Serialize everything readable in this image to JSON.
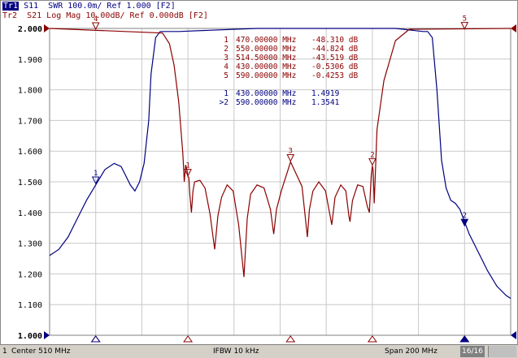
{
  "header": {
    "tr1_tag": "Tr1",
    "tr1_text": " S11  SWR 100.0m/ Ref 1.000 [F2]",
    "tr2_text": "Tr2  S21 Log Mag 10.00dB/ Ref 0.000dB [F2]"
  },
  "colors": {
    "tr1": "#000080",
    "tr2": "#8b0000",
    "grid": "#c8c8c8",
    "background": "#ffffff"
  },
  "marker_table": {
    "tr2": [
      {
        "num": "1",
        "freq": "470.00000 MHz",
        "value": "-48.310 dB"
      },
      {
        "num": "2",
        "freq": "550.00000 MHz",
        "value": "-44.824 dB"
      },
      {
        "num": "3",
        "freq": "514.50000 MHz",
        "value": "-43.519 dB"
      },
      {
        "num": "4",
        "freq": "430.00000 MHz",
        "value": "-0.5306 dB"
      },
      {
        "num": "5",
        "freq": "590.00000 MHz",
        "value": "-0.4253 dB"
      }
    ],
    "tr1": [
      {
        "num": "1",
        "freq": "430.00000 MHz",
        "value": "1.4919"
      },
      {
        "num": ">2",
        "freq": "590.00000 MHz",
        "value": "1.3541"
      }
    ]
  },
  "status": {
    "channel": "1",
    "start": "Center 510 MHz",
    "ifbw": "IFBW 10 kHz",
    "stop": "Span 200 MHz",
    "count": "16/16"
  },
  "chart_data": {
    "type": "line",
    "xlabel": "",
    "ylabel": "",
    "xlim": [
      410,
      610
    ],
    "ylim": [
      1.0,
      2.0
    ],
    "y_ticks": [
      "1.000",
      "1.100",
      "1.200",
      "1.300",
      "1.400",
      "1.500",
      "1.600",
      "1.700",
      "1.800",
      "1.900",
      "2.000"
    ],
    "grid": true,
    "series": [
      {
        "name": "Tr1",
        "color": "#000080",
        "x": [
          410,
          414,
          418,
          422,
          426,
          430,
          434,
          438,
          441,
          443,
          445,
          447,
          449,
          451,
          453,
          454,
          456,
          458,
          460,
          466,
          500,
          560,
          572,
          574,
          576,
          578,
          580,
          582,
          584,
          586,
          588,
          590,
          592,
          596,
          600,
          604,
          608,
          610
        ],
        "y": [
          1.26,
          1.28,
          1.32,
          1.38,
          1.44,
          1.49,
          1.54,
          1.56,
          1.55,
          1.52,
          1.49,
          1.47,
          1.5,
          1.56,
          1.7,
          1.85,
          1.97,
          1.99,
          1.99,
          1.99,
          2.0,
          2.0,
          1.99,
          1.99,
          1.97,
          1.8,
          1.57,
          1.48,
          1.44,
          1.43,
          1.41,
          1.37,
          1.33,
          1.27,
          1.21,
          1.16,
          1.13,
          1.12
        ]
      },
      {
        "name": "Tr2",
        "color": "#8b0000",
        "x": [
          410,
          459,
          462,
          464,
          466,
          467.8,
          468.4,
          469,
          469.5,
          470,
          470.4,
          470.8,
          471.5,
          472.2,
          472.9,
          475.2,
          477.4,
          479.6,
          481.6,
          483,
          484.6,
          487,
          489.6,
          492,
          494.3,
          495.7,
          497.2,
          500,
          503,
          505.8,
          507.2,
          508.4,
          510.5,
          514.5,
          519.5,
          521.8,
          522.7,
          524.2,
          526.8,
          529.7,
          531.4,
          532.4,
          533.8,
          536.3,
          538.5,
          539.8,
          540.3,
          541.4,
          543.6,
          545.9,
          547.8,
          548.7,
          549.5,
          550,
          550.3,
          550.8,
          552,
          555,
          560,
          566,
          610
        ],
        "y": [
          0,
          -1.5,
          -5,
          -12,
          -24,
          -41,
          -50,
          -44.5,
          -46,
          -48.3,
          -48.5,
          -54,
          -60,
          -53,
          -50,
          -49.5,
          -52,
          -60.5,
          -72,
          -61,
          -55,
          -51,
          -53,
          -64,
          -81,
          -62,
          -54,
          -51,
          -52,
          -59,
          -67,
          -59,
          -53,
          -43.5,
          -51.5,
          -68,
          -59,
          -53,
          -50,
          -53,
          -60,
          -64,
          -55,
          -51,
          -53,
          -61,
          -63,
          -56,
          -51,
          -51.5,
          -58,
          -60,
          -48,
          -44.8,
          -46,
          -57,
          -33,
          -17,
          -4,
          -0.3,
          0
        ]
      }
    ],
    "markers": [
      {
        "trace": "Tr2",
        "label": "1",
        "x": 470,
        "y": -48.31
      },
      {
        "trace": "Tr2",
        "label": "2",
        "x": 550,
        "y": -44.824
      },
      {
        "trace": "Tr2",
        "label": "3",
        "x": 514.5,
        "y": -43.519
      },
      {
        "trace": "Tr2",
        "label": "4",
        "x": 430,
        "y": -0.5306
      },
      {
        "trace": "Tr2",
        "label": "5",
        "x": 590,
        "y": -0.4253
      },
      {
        "trace": "Tr1",
        "label": "1",
        "x": 430,
        "y": 1.4919
      },
      {
        "trace": "Tr1",
        "label": "2",
        "x": 590,
        "y": 1.3541
      }
    ]
  }
}
